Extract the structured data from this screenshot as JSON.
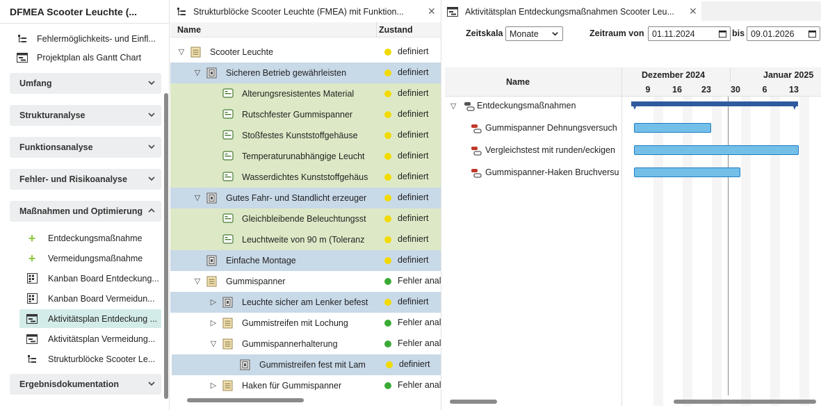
{
  "sidebar": {
    "title": "DFMEA Scooter Leuchte (...",
    "top_links": [
      {
        "label": "Fehlermöglichkeits- und Einfl...",
        "icon": "tree-icon"
      },
      {
        "label": "Projektplan als Gantt Chart",
        "icon": "gantt-icon"
      }
    ],
    "sections": [
      {
        "label": "Umfang"
      },
      {
        "label": "Strukturanalyse"
      },
      {
        "label": "Funktionsanalyse"
      },
      {
        "label": "Fehler- und Risikoanalyse"
      },
      {
        "label": "Maßnahmen und Optimierung"
      },
      {
        "label": "Ergebnisdokumentation"
      }
    ],
    "sub_items": [
      {
        "label": "Entdeckungsmaßnahme",
        "icon": "plus-icon"
      },
      {
        "label": "Vermeidungsmaßnahme",
        "icon": "plus-icon"
      },
      {
        "label": "Kanban Board Entdeckung...",
        "icon": "kanban-icon"
      },
      {
        "label": "Kanban Board Vermeidun...",
        "icon": "kanban-icon"
      },
      {
        "label": "Aktivitätsplan Entdeckung ...",
        "icon": "gantt-icon"
      },
      {
        "label": "Aktivitätsplan Vermeidung...",
        "icon": "gantt-icon"
      },
      {
        "label": "Strukturblöcke Scooter Le...",
        "icon": "tree-icon"
      }
    ]
  },
  "tree": {
    "tab_title": "Strukturblöcke Scooter Leuchte (FMEA) mit Funktion...",
    "col_name": "Name",
    "col_state": "Zustand",
    "rows": [
      {
        "label": "Scooter Leuchte",
        "state": "definiert",
        "icon": "block-icon",
        "toggle": "▽"
      },
      {
        "label": "Sicheren Betrieb gewährleisten",
        "state": "definiert",
        "icon": "function-icon",
        "toggle": "▽"
      },
      {
        "label": "Alterungsresistentes Material",
        "state": "definiert",
        "icon": "requirement-icon",
        "toggle": ""
      },
      {
        "label": "Rutschfester Gummispanner",
        "state": "definiert",
        "icon": "requirement-icon",
        "toggle": ""
      },
      {
        "label": "Stoßfestes Kunststoffgehäuse",
        "state": "definiert",
        "icon": "requirement-icon",
        "toggle": ""
      },
      {
        "label": "Temperaturunabhängige Leucht",
        "state": "definiert",
        "icon": "requirement-icon",
        "toggle": ""
      },
      {
        "label": "Wasserdichtes Kunststoffgehäus",
        "state": "definiert",
        "icon": "requirement-icon",
        "toggle": ""
      },
      {
        "label": "Gutes Fahr- und Standlicht erzeuger",
        "state": "definiert",
        "icon": "function-icon",
        "toggle": "▽"
      },
      {
        "label": "Gleichbleibende Beleuchtungsst",
        "state": "definiert",
        "icon": "requirement-icon",
        "toggle": ""
      },
      {
        "label": "Leuchtweite von 90 m (Toleranz",
        "state": "definiert",
        "icon": "requirement-icon",
        "toggle": ""
      },
      {
        "label": "Einfache Montage",
        "state": "definiert",
        "icon": "function-icon",
        "toggle": ""
      },
      {
        "label": "Gummispanner",
        "state": "Fehler anal",
        "icon": "block-icon",
        "toggle": "▽"
      },
      {
        "label": "Leuchte sicher am Lenker befest",
        "state": "definiert",
        "icon": "function-icon",
        "toggle": "▷"
      },
      {
        "label": "Gummistreifen mit Lochung",
        "state": "Fehler anal",
        "icon": "block-icon",
        "toggle": "▷"
      },
      {
        "label": "Gummispannerhalterung",
        "state": "Fehler anal",
        "icon": "block-icon",
        "toggle": "▽"
      },
      {
        "label": "Gummistreifen fest mit Lam",
        "state": "definiert",
        "icon": "function-icon",
        "toggle": ""
      },
      {
        "label": "Haken für Gummispanner",
        "state": "Fehler anal",
        "icon": "block-icon",
        "toggle": "▷"
      }
    ]
  },
  "gantt": {
    "tab_title": "Aktivitätsplan Entdeckungsmaßnahmen Scooter Leu...",
    "zeitskala_label": "Zeitskala",
    "zeitskala_value": "Monate",
    "zeitraum_label": "Zeitraum von",
    "from_date": "01.11.2024",
    "bis_label": "bis",
    "to_date": "09.01.2026",
    "col_name": "Name",
    "months": [
      "Dezember 2024",
      "Januar 2025"
    ],
    "days": [
      "9",
      "16",
      "23",
      "30",
      "6",
      "13"
    ],
    "rows": [
      {
        "label": "Entdeckungsmaßnahmen",
        "icon": "group-icon"
      },
      {
        "label": "Gummispanner Dehnungsversuch",
        "icon": "activity-icon"
      },
      {
        "label": "Vergleichstest mit runden/eckigen",
        "icon": "activity-icon"
      },
      {
        "label": "Gummispanner-Haken Bruchversu",
        "icon": "activity-icon"
      }
    ]
  },
  "colors": {
    "dot_defined": "#f2da00",
    "dot_fehler": "#3aaa35",
    "bar_fill": "#73bfe8",
    "summary_bar": "#2f5a9e"
  }
}
